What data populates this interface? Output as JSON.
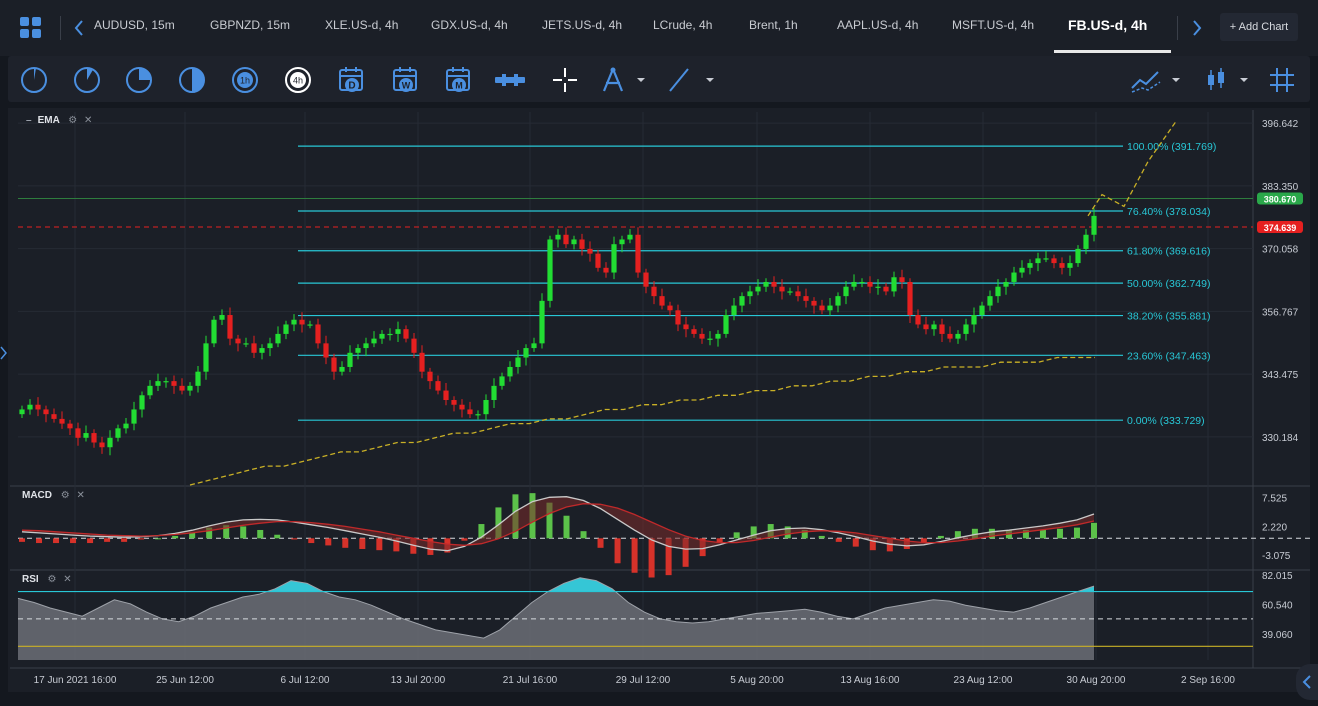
{
  "tabs": [
    {
      "label": "AUDUSD, 15m",
      "active": false
    },
    {
      "label": "GBPNZD, 15m",
      "active": false
    },
    {
      "label": "XLE.US-d, 4h",
      "active": false
    },
    {
      "label": "GDX.US-d, 4h",
      "active": false
    },
    {
      "label": "JETS.US-d, 4h",
      "active": false
    },
    {
      "label": "LCrude, 4h",
      "active": false
    },
    {
      "label": "Brent, 1h",
      "active": false
    },
    {
      "label": "AAPL.US-d, 4h",
      "active": false
    },
    {
      "label": "MSFT.US-d, 4h",
      "active": false
    },
    {
      "label": "FB.US-d, 4h",
      "active": true
    }
  ],
  "add_chart_label": "+ Add Chart",
  "toolbar": {
    "timeframe_icons": [
      "1m-clock-icon",
      "5m-clock-icon",
      "15m-clock-icon",
      "30m-clock-icon",
      "1h-clock-icon",
      "4h-clock-icon"
    ],
    "hour_labels": {
      "h1": "1h",
      "h4": "4h"
    },
    "calendar_labels": {
      "day": "D",
      "week": "W",
      "month": "M"
    }
  },
  "indicators": {
    "ema_label": "EMA",
    "macd_label": "MACD",
    "rsi_label": "RSI"
  },
  "colors": {
    "up_candle": "#22dd33",
    "down_candle": "#e52020",
    "fib_line": "#28c7d6",
    "ema_line": "#c9b026",
    "accent": "#4a8fe0",
    "price_badge": "#2aa84a",
    "red_badge": "#e52020"
  },
  "chart_data": [
    {
      "type": "candlestick",
      "title": "FB.US-d, 4h",
      "ylim": [
        320.0,
        399.0
      ],
      "y_ticks": [
        {
          "value": 396.642,
          "label": "396.642"
        },
        {
          "value": 383.35,
          "label": "383.350"
        },
        {
          "value": 370.058,
          "label": "370.058"
        },
        {
          "value": 356.767,
          "label": "356.767"
        },
        {
          "value": 343.475,
          "label": "343.475"
        },
        {
          "value": 330.184,
          "label": "330.184"
        }
      ],
      "x_ticks": [
        "17 Jun 2021 16:00",
        "25 Jun 12:00",
        "6 Jul 12:00",
        "13 Jul 20:00",
        "21 Jul 16:00",
        "29 Jul 12:00",
        "5 Aug 20:00",
        "13 Aug 16:00",
        "23 Aug 12:00",
        "30 Aug 20:00",
        "2 Sep 16:00"
      ],
      "current_price": {
        "value": 380.67,
        "label": "380.670"
      },
      "red_line": {
        "value": 374.639,
        "label": "374.639"
      },
      "fib_levels": [
        {
          "pct": "100.00%",
          "value": 391.769,
          "label": "100.00% (391.769)"
        },
        {
          "pct": "76.40%",
          "value": 378.034,
          "label": "76.40% (378.034)"
        },
        {
          "pct": "61.80%",
          "value": 369.616,
          "label": "61.80% (369.616)"
        },
        {
          "pct": "50.00%",
          "value": 362.749,
          "label": "50.00% (362.749)"
        },
        {
          "pct": "38.20%",
          "value": 355.881,
          "label": "38.20% (355.881)"
        },
        {
          "pct": "23.60%",
          "value": 347.463,
          "label": "23.60% (347.463)"
        },
        {
          "pct": "0.00%",
          "value": 333.729,
          "label": "0.00% (333.729)"
        }
      ],
      "closes": [
        336,
        337,
        336,
        335,
        334,
        333,
        332,
        330,
        331,
        329,
        328,
        330,
        332,
        333,
        336,
        339,
        341,
        342,
        342,
        341,
        340,
        341,
        344,
        350,
        355,
        356,
        351,
        350,
        350,
        348,
        349,
        350,
        352,
        354,
        355,
        354,
        354,
        350,
        347,
        344,
        345,
        348,
        349,
        350,
        351,
        352,
        352,
        353,
        351,
        348,
        344,
        342,
        340,
        338,
        337,
        336,
        335,
        335,
        338,
        341,
        343,
        345,
        347,
        349,
        350,
        359,
        372,
        373,
        371,
        372,
        370,
        369,
        366,
        365,
        371,
        372,
        373,
        365,
        362,
        360,
        358,
        357,
        354,
        353,
        352,
        351,
        351,
        352,
        356,
        358,
        360,
        361,
        362,
        363,
        362,
        361,
        361,
        360,
        359,
        358,
        357,
        358,
        360,
        362,
        363,
        363,
        362,
        362,
        361,
        364,
        363,
        356,
        354,
        353,
        354,
        352,
        351,
        352,
        354,
        356,
        358,
        360,
        362,
        363,
        365,
        366,
        367,
        368,
        368,
        367,
        366,
        367,
        370,
        373,
        377
      ],
      "ema_values": [
        320,
        321,
        322,
        323,
        324,
        324,
        325,
        326,
        327,
        327,
        328,
        329,
        329,
        330,
        331,
        331,
        332,
        333,
        333,
        334,
        334,
        335,
        336,
        336,
        337,
        337,
        338,
        338,
        339,
        339,
        340,
        340,
        341,
        341,
        342,
        342,
        343,
        343,
        344,
        344,
        345,
        345,
        345,
        346,
        346,
        346,
        347,
        347,
        347
      ],
      "projection": [
        377,
        381.5,
        379,
        388.5,
        397
      ]
    },
    {
      "type": "line",
      "title": "MACD",
      "ylim": [
        -5.5,
        9.5
      ],
      "y_ticks": [
        {
          "value": 7.525,
          "label": "7.525"
        },
        {
          "value": 2.22,
          "label": "2.220"
        },
        {
          "value": -3.075,
          "label": "-3.075"
        }
      ],
      "macd": [
        1.2,
        1.0,
        0.8,
        0.6,
        0.4,
        0.3,
        0.2,
        0.3,
        0.5,
        0.9,
        1.5,
        2.3,
        3.0,
        3.4,
        3.5,
        3.4,
        3.0,
        2.5,
        2.0,
        1.4,
        0.8,
        0.2,
        -0.5,
        -1.3,
        -2.0,
        -2.3,
        -1.5,
        0.2,
        2.5,
        5.0,
        6.8,
        7.6,
        7.7,
        7.0,
        5.5,
        3.5,
        1.5,
        -0.3,
        -1.5,
        -2.0,
        -1.9,
        -1.2,
        -0.3,
        0.6,
        1.4,
        1.8,
        1.9,
        1.6,
        1.0,
        0.3,
        -0.5,
        -1.1,
        -1.4,
        -1.2,
        -0.6,
        0.1,
        0.7,
        1.2,
        1.5,
        1.9,
        2.3,
        2.8,
        3.4,
        4.5
      ],
      "signal": [
        1.5,
        1.4,
        1.2,
        1.0,
        0.8,
        0.6,
        0.5,
        0.4,
        0.5,
        0.7,
        1.0,
        1.4,
        1.9,
        2.4,
        2.8,
        3.1,
        3.1,
        2.9,
        2.6,
        2.2,
        1.7,
        1.2,
        0.6,
        0.0,
        -0.6,
        -1.1,
        -1.3,
        -1.0,
        -0.1,
        1.3,
        3.0,
        4.6,
        5.8,
        6.4,
        6.3,
        5.6,
        4.4,
        3.0,
        1.6,
        0.4,
        -0.4,
        -0.8,
        -0.8,
        -0.4,
        0.2,
        0.8,
        1.2,
        1.4,
        1.3,
        1.0,
        0.5,
        0.0,
        -0.5,
        -0.8,
        -0.8,
        -0.5,
        -0.1,
        0.4,
        0.8,
        1.2,
        1.6,
        2.0,
        2.5,
        3.2
      ]
    },
    {
      "type": "area",
      "title": "RSI",
      "ylim": [
        20,
        85
      ],
      "y_ticks": [
        {
          "value": 82.015,
          "label": "82.015"
        },
        {
          "value": 60.54,
          "label": "60.540"
        },
        {
          "value": 39.06,
          "label": "39.060"
        }
      ],
      "overbought": 70,
      "oversold": 30,
      "mid": 50,
      "values": [
        65,
        62,
        58,
        55,
        52,
        58,
        64,
        61,
        55,
        50,
        48,
        52,
        58,
        62,
        66,
        68,
        72,
        78,
        76,
        70,
        66,
        64,
        60,
        55,
        50,
        46,
        42,
        40,
        38,
        36,
        42,
        52,
        62,
        70,
        76,
        80,
        78,
        72,
        62,
        55,
        50,
        48,
        47,
        48,
        50,
        52,
        54,
        55,
        56,
        57,
        55,
        52,
        50,
        54,
        58,
        60,
        62,
        64,
        63,
        60,
        58,
        56,
        55,
        58,
        62,
        66,
        70,
        74
      ]
    }
  ]
}
